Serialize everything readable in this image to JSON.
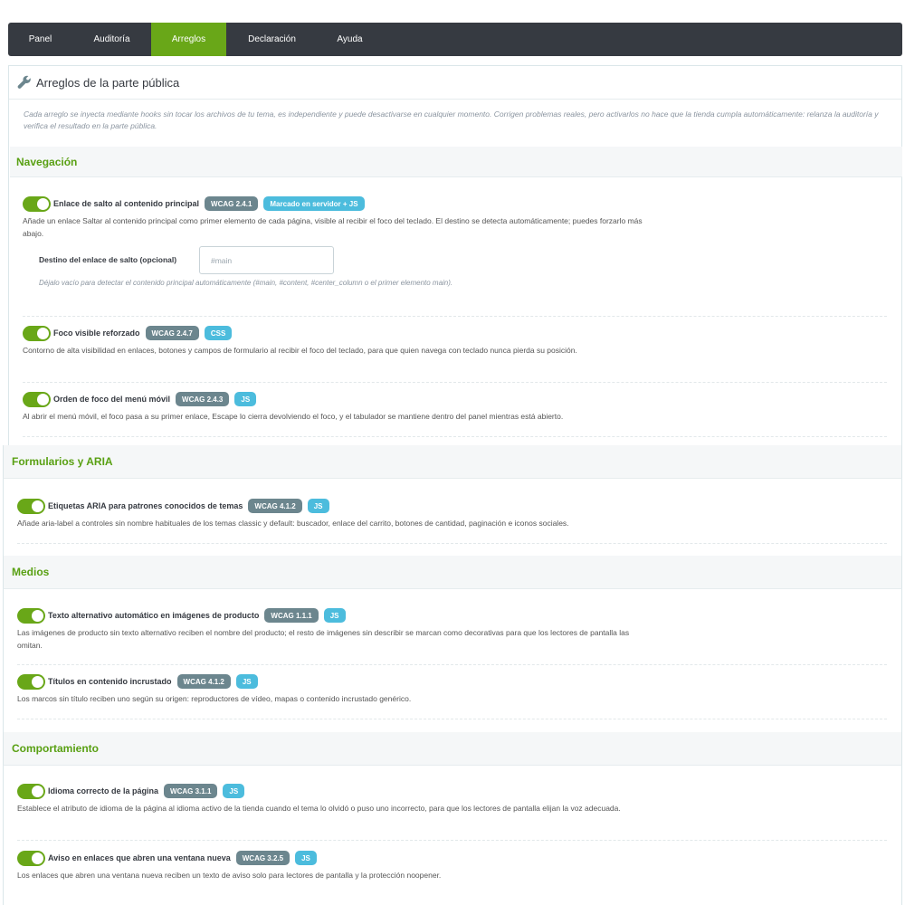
{
  "nav": {
    "tabs": [
      {
        "label": "Panel",
        "active": false
      },
      {
        "label": "Auditoría",
        "active": false
      },
      {
        "label": "Arreglos",
        "active": true
      },
      {
        "label": "Declaración",
        "active": false
      },
      {
        "label": "Ayuda",
        "active": false
      }
    ]
  },
  "panel": {
    "title": "Arreglos de la parte pública",
    "icon": "wrench-icon",
    "intro": "Cada arreglo se inyecta mediante hooks sin tocar los archivos de tu tema, es independiente y puede desactivarse en cualquier momento. Corrigen problemas reales, pero activarlos no hace que la tienda cumpla automáticamente: relanza la auditoría y verifica el resultado en la parte pública."
  },
  "sections": {
    "navigation": {
      "title": "Navegación",
      "fixes": [
        {
          "title": "Enlace de salto al contenido principal",
          "wcag": "WCAG 2.4.1",
          "tech": "Marcado en servidor + JS",
          "enabled": true,
          "desc": "Añade un enlace Saltar al contenido principal como primer elemento de cada página, visible al recibir el foco del teclado. El destino se detecta automáticamente; puedes forzarlo más abajo."
        },
        {
          "title": "Foco visible reforzado",
          "wcag": "WCAG 2.4.7",
          "tech": "CSS",
          "enabled": true,
          "desc": "Contorno de alta visibilidad en enlaces, botones y campos de formulario al recibir el foco del teclado, para que quien navega con teclado nunca pierda su posición."
        },
        {
          "title": "Orden de foco del menú móvil",
          "wcag": "WCAG 2.4.3",
          "tech": "JS",
          "enabled": true,
          "desc": "Al abrir el menú móvil, el foco pasa a su primer enlace, Escape lo cierra devolviendo el foco, y el tabulador se mantiene dentro del panel mientras está abierto."
        }
      ],
      "skip_field": {
        "label": "Destino del enlace de salto (opcional)",
        "placeholder": "#main",
        "value": "",
        "help": "Déjalo vacío para detectar el contenido principal automáticamente (#main, #content, #center_column o el primer elemento main)."
      }
    },
    "forms": {
      "title": "Formularios y ARIA",
      "fixes": [
        {
          "title": "Etiquetas ARIA para patrones conocidos de temas",
          "wcag": "WCAG 4.1.2",
          "tech": "JS",
          "enabled": true,
          "desc": "Añade aria-label a controles sin nombre habituales de los temas classic y default: buscador, enlace del carrito, botones de cantidad, paginación e iconos sociales."
        }
      ]
    },
    "media": {
      "title": "Medios",
      "fixes": [
        {
          "title": "Texto alternativo automático en imágenes de producto",
          "wcag": "WCAG 1.1.1",
          "tech": "JS",
          "enabled": true,
          "desc": "Las imágenes de producto sin texto alternativo reciben el nombre del producto; el resto de imágenes sin describir se marcan como decorativas para que los lectores de pantalla las omitan."
        },
        {
          "title": "Títulos en contenido incrustado",
          "wcag": "WCAG 4.1.2",
          "tech": "JS",
          "enabled": true,
          "desc": "Los marcos sin título reciben uno según su origen: reproductores de vídeo, mapas o contenido incrustado genérico."
        }
      ]
    },
    "behavior": {
      "title": "Comportamiento",
      "fixes": [
        {
          "title": "Idioma correcto de la página",
          "wcag": "WCAG 3.1.1",
          "tech": "JS",
          "enabled": true,
          "desc": "Establece el atributo de idioma de la página al idioma activo de la tienda cuando el tema lo olvidó o puso uno incorrecto, para que los lectores de pantalla elijan la voz adecuada."
        },
        {
          "title": "Aviso en enlaces que abren una ventana nueva",
          "wcag": "WCAG 3.2.5",
          "tech": "JS",
          "enabled": true,
          "desc": "Los enlaces que abren una ventana nueva reciben un texto de aviso solo para lectores de pantalla y la protección noopener."
        }
      ]
    }
  },
  "colors": {
    "nav_bg": "#363a41",
    "accent": "#69a718",
    "section_title": "#59a013",
    "wcag_badge": "#6c868e",
    "tech_badge": "#4cbcdd"
  }
}
